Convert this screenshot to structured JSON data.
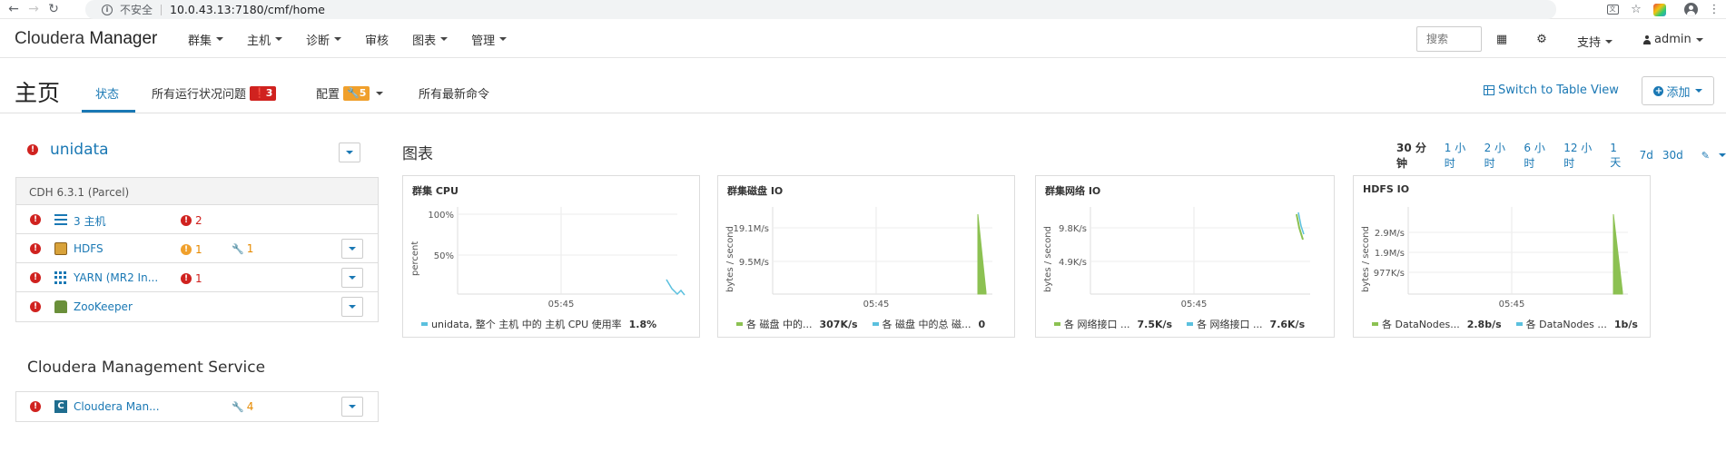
{
  "browser": {
    "insecure_label": "不安全",
    "url": "10.0.43.13:7180/cmf/home"
  },
  "navbar": {
    "brand_part1": "Cloudera",
    "brand_part2": "Manager",
    "menu": [
      "群集",
      "主机",
      "诊断",
      "审核",
      "图表",
      "管理"
    ],
    "search_placeholder": "搜索",
    "support": "支持",
    "admin": "admin"
  },
  "subheader": {
    "title": "主页",
    "tabs": {
      "status": "状态",
      "health_issues": "所有运行状况问题",
      "health_count": "3",
      "config": "配置",
      "config_count": "5",
      "commands": "所有最新命令"
    },
    "switch_view": "Switch to Table View",
    "add": "添加"
  },
  "cluster": {
    "name": "unidata",
    "version": "CDH 6.3.1 (Parcel)",
    "rows": [
      {
        "name": "3 主机",
        "health": "2",
        "config": ""
      },
      {
        "name": "HDFS",
        "health": "1",
        "config": "1"
      },
      {
        "name": "YARN (MR2 In...",
        "health": "1",
        "config": ""
      },
      {
        "name": "ZooKeeper",
        "health": "",
        "config": ""
      }
    ]
  },
  "management": {
    "title": "Cloudera Management Service",
    "rows": [
      {
        "name": "Cloudera Man...",
        "config": "4"
      }
    ]
  },
  "charts": {
    "title": "图表",
    "time_ranges": [
      "30 分钟",
      "1 小时",
      "2 小时",
      "6 小时",
      "12 小时",
      "1 天",
      "7d",
      "30d"
    ],
    "selected_range": "30 分钟",
    "colors": {
      "green": "#8cc152",
      "blue": "#5bc0de"
    }
  },
  "chart_data": [
    {
      "type": "line",
      "title": "群集 CPU",
      "ylabel": "percent",
      "yticks": [
        "100%",
        "50%"
      ],
      "xticks": [
        "05:45"
      ],
      "series": [
        {
          "name": "unidata, 整个 主机 中的 主机 CPU 使用率",
          "value": "1.8%",
          "color": "#5bc0de"
        }
      ]
    },
    {
      "type": "area",
      "title": "群集磁盘 IO",
      "ylabel": "bytes / second",
      "yticks": [
        "19.1M/s",
        "9.5M/s"
      ],
      "xticks": [
        "05:45"
      ],
      "series": [
        {
          "name": "各 磁盘 中的...",
          "value": "307K/s",
          "color": "#8cc152"
        },
        {
          "name": "各 磁盘 中的总 磁...",
          "value": "0",
          "color": "#5bc0de"
        }
      ]
    },
    {
      "type": "line",
      "title": "群集网络 IO",
      "ylabel": "bytes / second",
      "yticks": [
        "9.8K/s",
        "4.9K/s"
      ],
      "xticks": [
        "05:45"
      ],
      "series": [
        {
          "name": "各 网络接口 ...",
          "value": "7.5K/s",
          "color": "#8cc152"
        },
        {
          "name": "各 网络接口 ...",
          "value": "7.6K/s",
          "color": "#5bc0de"
        }
      ]
    },
    {
      "type": "area",
      "title": "HDFS IO",
      "ylabel": "bytes / second",
      "yticks": [
        "2.9M/s",
        "1.9M/s",
        "977K/s"
      ],
      "xticks": [
        "05:45"
      ],
      "series": [
        {
          "name": "各 DataNodes...",
          "value": "2.8b/s",
          "color": "#8cc152"
        },
        {
          "name": "各 DataNodes ...",
          "value": "1b/s",
          "color": "#5bc0de"
        }
      ]
    }
  ]
}
